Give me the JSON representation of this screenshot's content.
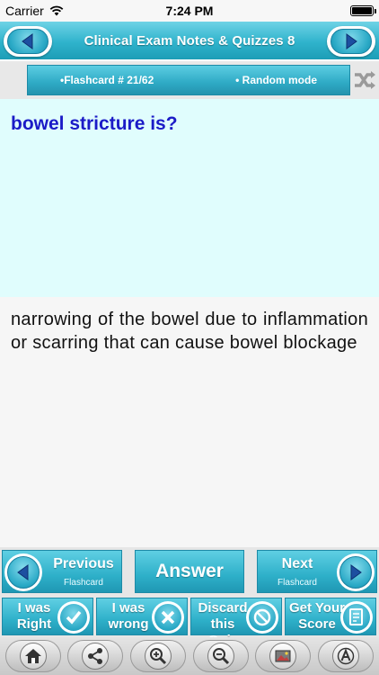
{
  "status_bar": {
    "carrier": "Carrier",
    "time": "7:24 PM"
  },
  "header": {
    "title": "Clinical Exam  Notes & Quizzes 8"
  },
  "flashcard_info": {
    "counter": "•Flashcard #  21/62",
    "mode": "• Random mode"
  },
  "question": {
    "text": "bowel stricture is?"
  },
  "answer": {
    "text": "narrowing of the bowel due to inflammation or scarring that can cause bowel blockage"
  },
  "actions": {
    "previous_label": "Previous",
    "previous_sub": "Flashcard",
    "answer_label": "Answer",
    "next_label": "Next",
    "next_sub": "Flashcard"
  },
  "score_buttons": [
    {
      "line1": "I was",
      "line2": "Right"
    },
    {
      "line1": "I was",
      "line2": "wrong"
    },
    {
      "line1": "Discard",
      "line2": "this Quiz"
    },
    {
      "line1": "Get Your",
      "line2": "Score"
    }
  ],
  "toolbar_icons": [
    "home-icon",
    "share-icon",
    "zoom-in-icon",
    "zoom-out-icon",
    "background-image-icon",
    "font-icon"
  ],
  "colors": {
    "accent": "#2eb0c9",
    "question_bg": "#e0fdfd",
    "question_text": "#1b1bc7"
  }
}
